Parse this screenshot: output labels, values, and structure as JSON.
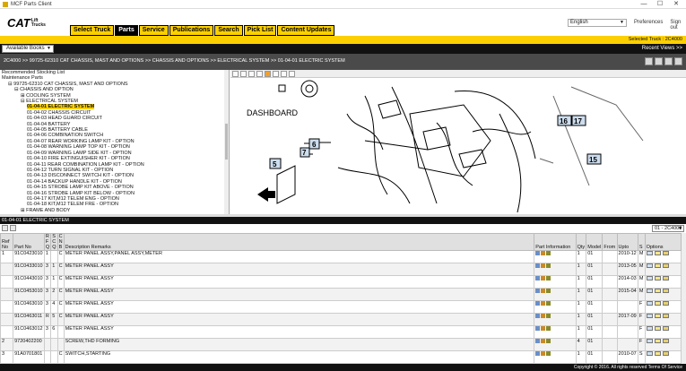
{
  "window": {
    "title": "MCF Parts Client",
    "min": "—",
    "max": "☐",
    "close": "✕"
  },
  "logo": {
    "brand": "CAT",
    "line1": "Lift",
    "line2": "Trucks"
  },
  "tabs": [
    "Select Truck",
    "Parts",
    "Service",
    "Publications",
    "Search",
    "Pick List",
    "Content Updates"
  ],
  "language": "English",
  "toplinks": {
    "prefs": "Preferences",
    "signout": "Sign out"
  },
  "selected_truck": "Selected Truck : 2C4000",
  "available_books": "Available Books",
  "recent": "Recent Views >>",
  "breadcrumb": "2C4000 >> 99725-62310 CAT CHASSIS, MAST AND OPTIONS >> CHASSIS AND OPTIONS >> ELECTRICAL SYSTEM >> 01-04-01 ELECTRIC SYSTEM",
  "tree": [
    {
      "label": "Recommended Stocking List",
      "indent": 0
    },
    {
      "label": "Maintenance Parts",
      "indent": 0
    },
    {
      "label": "⊟ 99725-62310 CAT CHASSIS, MAST AND OPTIONS",
      "indent": 1
    },
    {
      "label": "⊟ CHASSIS AND OPTION",
      "indent": 2
    },
    {
      "label": "⊞ COOLING SYSTEM",
      "indent": 3
    },
    {
      "label": "⊟ ELECTRICAL SYSTEM",
      "indent": 3
    },
    {
      "label": "01-04-01 ELECTRIC SYSTEM",
      "indent": 4,
      "hl": true
    },
    {
      "label": "01-04-02 CHASSIS CIRCUIT",
      "indent": 4
    },
    {
      "label": "01-04-03 HEAD GUARD CIRCUIT",
      "indent": 4
    },
    {
      "label": "01-04-04 BATTERY",
      "indent": 4
    },
    {
      "label": "01-04-05 BATTERY CABLE",
      "indent": 4
    },
    {
      "label": "01-04-06 COMBINATION SWITCH",
      "indent": 4
    },
    {
      "label": "01-04-07 REAR WORKING LAMP KIT - OPTION",
      "indent": 4
    },
    {
      "label": "01-04-08 WARNING LAMP TOP KIT - OPTION",
      "indent": 4
    },
    {
      "label": "01-04-09 WARNING LAMP SIDE KIT - OPTION",
      "indent": 4
    },
    {
      "label": "01-04-10 FIRE EXTINGUISHER KIT - OPTION",
      "indent": 4
    },
    {
      "label": "01-04-11 REAR COMBINATION LAMP KIT - OPTION",
      "indent": 4
    },
    {
      "label": "01-04-12 TURN SIGNAL KIT - OPTION",
      "indent": 4
    },
    {
      "label": "01-04-13 DISCONNECT SWITCH KIT - OPTION",
      "indent": 4
    },
    {
      "label": "01-04-14 BACKUP HANDLE KIT - OPTION",
      "indent": 4
    },
    {
      "label": "01-04-15 STROBE LAMP KIT ABOVE - OPTION",
      "indent": 4
    },
    {
      "label": "01-04-16 STROBE LAMP KIT BELOW - OPTION",
      "indent": 4
    },
    {
      "label": "01-04-17 KIT,M12 TELEM ENG - OPTION",
      "indent": 4
    },
    {
      "label": "01-04-18 KIT,M12 TELEM FRE - OPTION",
      "indent": 4
    },
    {
      "label": "⊞ FRAME AND BODY",
      "indent": 3
    }
  ],
  "diagram": {
    "title": "DASHBOARD",
    "callouts": [
      "5",
      "6",
      "7",
      "15",
      "16",
      "17"
    ]
  },
  "section": "01-04-01 ELECTRIC SYSTEM",
  "serial_select": "01 - 2C4000",
  "columns": [
    "Ref No",
    "Part No",
    "R F Q",
    "S C Q",
    "C N B",
    "Description Remarks",
    "Part Information",
    "Qty",
    "Model",
    "From",
    "Upto",
    "S",
    "Options"
  ],
  "rows": [
    [
      "1",
      "91C0423010",
      "1",
      "",
      "C",
      "METER PANEL ASSY,PANEL ASSY,METER",
      "1",
      "01",
      "",
      "2010-12",
      "M"
    ],
    [
      "",
      "91C0433010",
      "3",
      "1",
      "C",
      "METER PANEL ASSY",
      "1",
      "01",
      "",
      "2013-05",
      "M"
    ],
    [
      "",
      "91C0443010",
      "3",
      "1",
      "C",
      "METER PANEL ASSY",
      "1",
      "01",
      "",
      "2014-03",
      "M"
    ],
    [
      "",
      "91C0453010",
      "3",
      "2",
      "C",
      "METER PANEL ASSY",
      "1",
      "01",
      "",
      "2015-04",
      "M"
    ],
    [
      "",
      "91C0463010",
      "3",
      "4",
      "C",
      "METER PANEL ASSY",
      "1",
      "01",
      "",
      "",
      "F"
    ],
    [
      "",
      "91C0463011",
      "R",
      "5",
      "C",
      "METER PANEL ASSY",
      "1",
      "01",
      "",
      "2017-09",
      "F"
    ],
    [
      "",
      "91C0463012",
      "3",
      "6",
      "",
      "METER PANEL ASSY",
      "1",
      "01",
      "",
      "",
      "F"
    ],
    [
      "2",
      "9720402200",
      "",
      "",
      "",
      "SCREW,THD FORMING",
      "4",
      "01",
      "",
      "",
      "F"
    ],
    [
      "3",
      "91A0701801",
      "",
      "",
      "C",
      "SWITCH,STARTING",
      "1",
      "01",
      "",
      "2010-07",
      "S"
    ]
  ],
  "footer": "Copyright © 2016. All rights reserved  Terms Of Service"
}
